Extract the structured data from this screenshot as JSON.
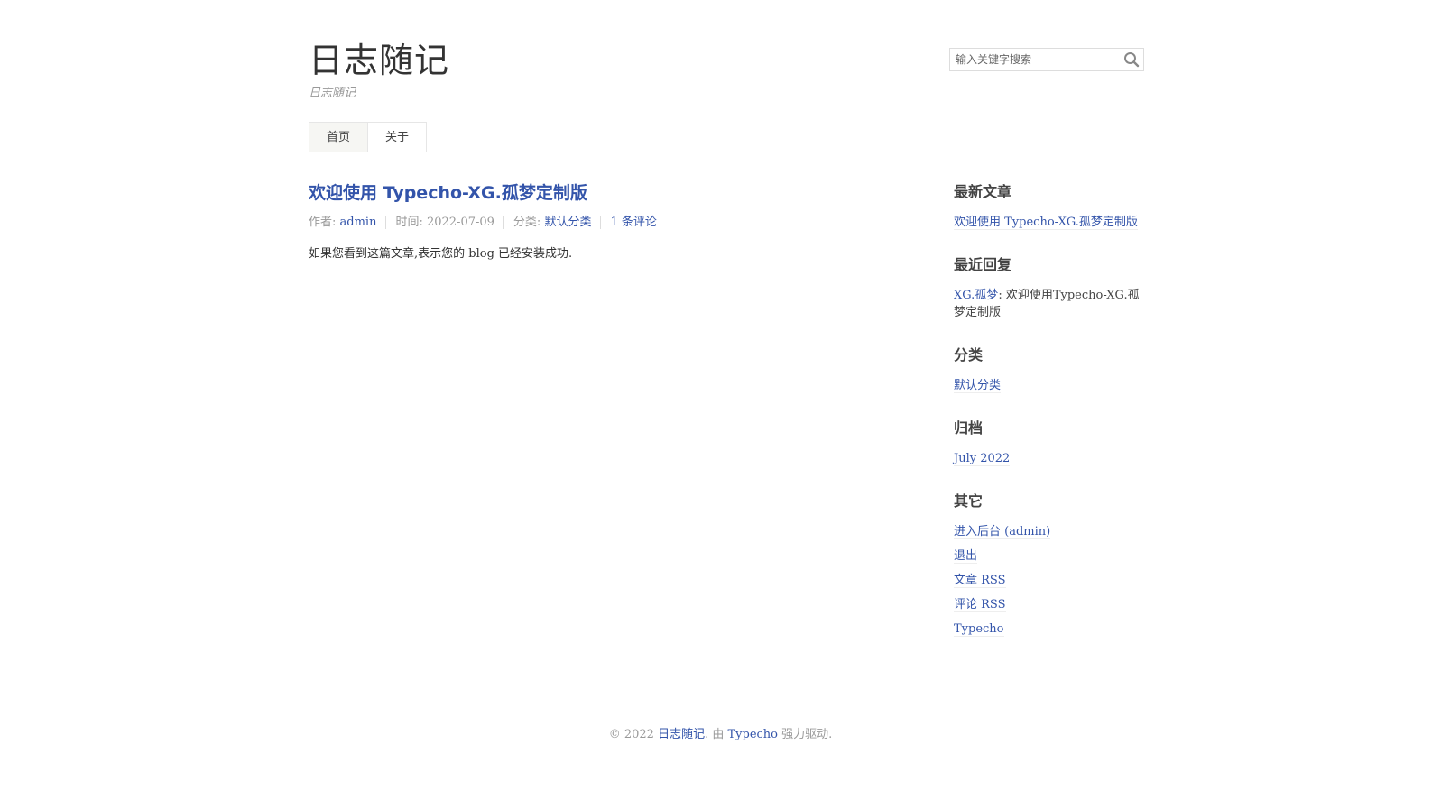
{
  "header": {
    "site_title": "日志随记",
    "site_desc": "日志随记",
    "search_placeholder": "输入关键字搜索",
    "nav": [
      {
        "label": "首页"
      },
      {
        "label": "关于"
      }
    ]
  },
  "post": {
    "title": "欢迎使用 Typecho-XG.孤梦定制版",
    "meta": {
      "author_label": "作者: ",
      "author": "admin",
      "time_label": "时间: ",
      "time": "2022-07-09",
      "category_label": "分类: ",
      "category": "默认分类",
      "comments": "1 条评论"
    },
    "content": "如果您看到这篇文章,表示您的 blog 已经安装成功."
  },
  "sidebar": {
    "recent_posts": {
      "title": "最新文章",
      "items": [
        "欢迎使用 Typecho-XG.孤梦定制版"
      ]
    },
    "recent_comments": {
      "title": "最近回复",
      "author": "XG.孤梦",
      "separator": ": ",
      "text": "欢迎使用Typecho-XG.孤梦定制版"
    },
    "categories": {
      "title": "分类",
      "items": [
        "默认分类"
      ]
    },
    "archives": {
      "title": "归档",
      "items": [
        "July 2022"
      ]
    },
    "other": {
      "title": "其它",
      "items": [
        "进入后台 (admin)",
        "退出",
        "文章 RSS",
        "评论 RSS",
        "Typecho"
      ]
    }
  },
  "footer": {
    "prefix": "© 2022 ",
    "site_link": "日志随记",
    "middle": ". 由 ",
    "typecho_link": "Typecho",
    "suffix": " 强力驱动."
  },
  "colors": {
    "link": "#3354AA",
    "text": "#444444",
    "muted": "#999999"
  }
}
